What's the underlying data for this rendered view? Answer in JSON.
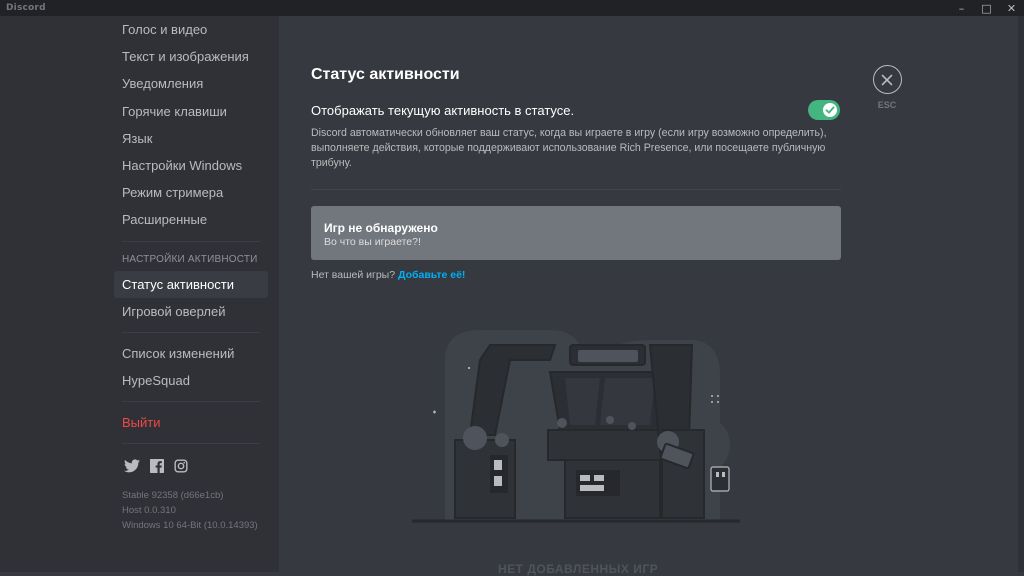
{
  "window": {
    "brand": "Discord",
    "controls": [
      "–",
      "□",
      "✕"
    ]
  },
  "sidebar": {
    "items_top": [
      {
        "label": "Голос и видео"
      },
      {
        "label": "Текст и изображения"
      },
      {
        "label": "Уведомления"
      },
      {
        "label": "Горячие клавиши"
      },
      {
        "label": "Язык"
      },
      {
        "label": "Настройки Windows"
      },
      {
        "label": "Режим стримера"
      },
      {
        "label": "Расширенные"
      }
    ],
    "activity_header": "НАСТРОЙКИ АКТИВНОСТИ",
    "activity_items": [
      {
        "label": "Статус активности",
        "active": true
      },
      {
        "label": "Игровой оверлей"
      }
    ],
    "misc_items": [
      {
        "label": "Список изменений"
      },
      {
        "label": "HypeSquad"
      }
    ],
    "logout": "Выйти",
    "socials": [
      "twitter-icon",
      "facebook-icon",
      "instagram-icon"
    ],
    "version": [
      "Stable 92358 (d66e1cb)",
      "Host 0.0.310",
      "Windows 10 64-Bit (10.0.14393)"
    ]
  },
  "main": {
    "title": "Статус активности",
    "toggle_label": "Отображать текущую активность в статусе.",
    "toggle_on": true,
    "description": "Discord автоматически обновляет ваш статус, когда вы играете в игру (если игру возможно определить), выполняете действия, которые поддерживают использование Rich Presence, или посещаете публичную трибуну.",
    "game_card": {
      "title": "Игр не обнаружено",
      "subtitle": "Во что вы играете?!"
    },
    "add_game_prefix": "Нет вашей игры?",
    "add_game_link": "Добавьте её!",
    "empty_title": "НЕТ ДОБАВЛЕННЫХ ИГР",
    "esc_label": "ESC"
  },
  "colors": {
    "accent_green": "#43b581",
    "link": "#00b0f4",
    "danger": "#f04747",
    "bg": "#36393f",
    "sidebar": "#2f3136"
  }
}
